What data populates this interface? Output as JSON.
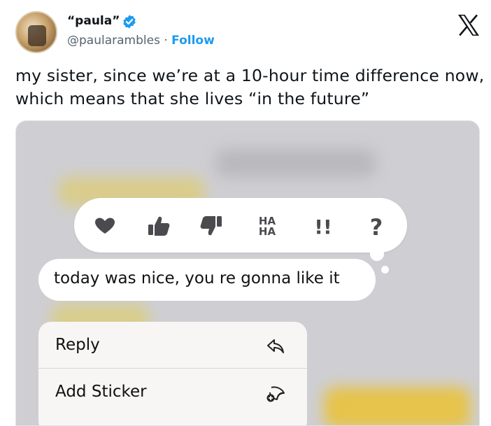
{
  "tweet": {
    "display_name": "“paula”",
    "handle": "@paularambles",
    "separator": "·",
    "follow_label": "Follow",
    "text": "my sister, since we’re at a 10-hour time difference now, which means that she lives “in the future”"
  },
  "message": {
    "bubble_text": "today was nice, you re gonna like it",
    "reactions": [
      "heart-icon",
      "thumbs-up-icon",
      "thumbs-down-icon",
      "haha-icon",
      "exclamation-icon",
      "question-icon"
    ],
    "reaction_labels": {
      "haha_top": "HA",
      "haha_bottom": "HA",
      "emphasis": "!!",
      "question": "?"
    },
    "menu": [
      {
        "label": "Reply",
        "icon": "reply-icon"
      },
      {
        "label": "Add Sticker",
        "icon": "sticker-icon"
      }
    ]
  },
  "colors": {
    "link": "#1d9bf0",
    "verified": "#1d9bf0",
    "reaction_icon": "#4a4a4f"
  }
}
